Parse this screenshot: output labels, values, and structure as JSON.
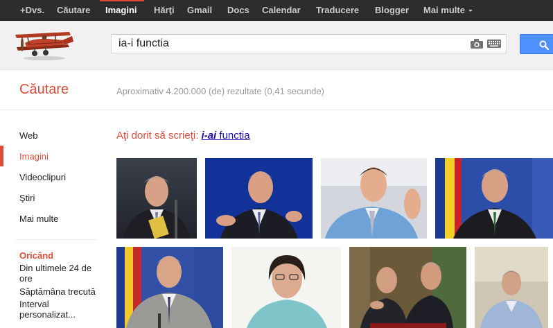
{
  "topbar": {
    "items": [
      "+Dvs.",
      "Căutare",
      "Imagini",
      "Hărţi",
      "Gmail",
      "Docs",
      "Calendar",
      "Traducere",
      "Blogger",
      "Mai multe"
    ],
    "active_index": 2
  },
  "search": {
    "query": "ia-i functia"
  },
  "results": {
    "section_title": "Căutare",
    "stats": "Aproximativ 4.200.000 (de) rezultate (0,41 secunde)"
  },
  "nav": {
    "items": [
      "Web",
      "Imagini",
      "Videoclipuri",
      "Ştiri",
      "Mai multe"
    ],
    "active_index": 1
  },
  "time_filter": {
    "title": "Oricând",
    "options": [
      "Din ultimele 24 de ore",
      "Săptămâna trecută",
      "Interval personalizat..."
    ]
  },
  "spelling": {
    "prefix": "Aţi dorit să scrieţi: ",
    "corrected": "i-ai",
    "rest": " functia"
  },
  "colors": {
    "accent_red": "#dd4b39",
    "link_blue": "#1a0dab",
    "search_blue": "#4d90fe",
    "topbar_bg": "#2d2d2d"
  },
  "icons": [
    "biplane-logo",
    "camera-icon",
    "keyboard-icon",
    "search-icon"
  ]
}
